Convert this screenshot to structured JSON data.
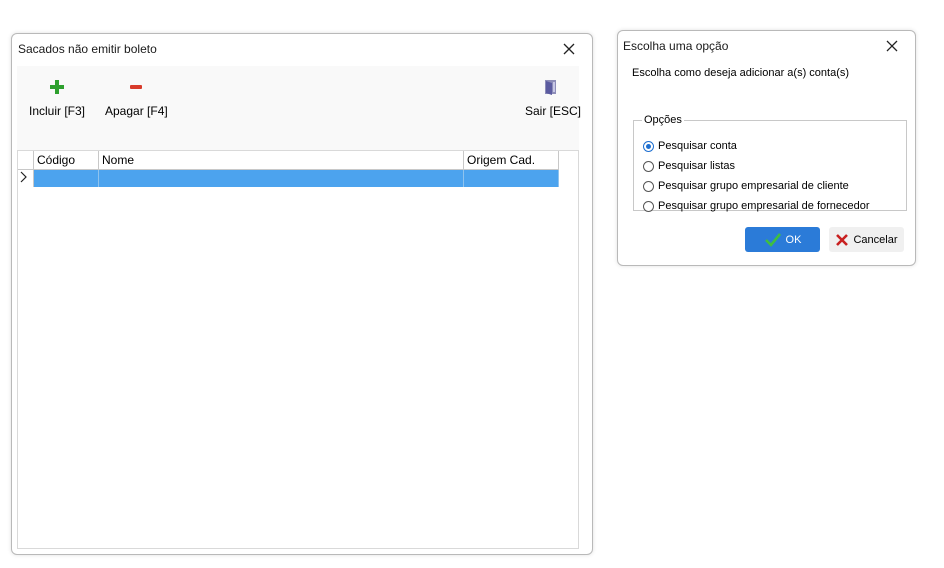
{
  "window1": {
    "title": "Sacados não emitir boleto",
    "toolbar": {
      "add_label": "Incluir [F3]",
      "delete_label": "Apagar [F4]",
      "exit_label": "Sair [ESC]"
    },
    "grid": {
      "columns": [
        "Código",
        "Nome",
        "Origem Cad."
      ],
      "rows": [
        [
          "",
          "",
          ""
        ]
      ]
    }
  },
  "window2": {
    "title": "Escolha uma opção",
    "prompt": "Escolha como deseja adicionar a(s) conta(s)",
    "group_label": "Opções",
    "options": [
      {
        "label": "Pesquisar conta",
        "selected": true
      },
      {
        "label": "Pesquisar listas",
        "selected": false
      },
      {
        "label": "Pesquisar grupo empresarial de cliente",
        "selected": false
      },
      {
        "label": "Pesquisar grupo empresarial de fornecedor",
        "selected": false
      }
    ],
    "ok_label": "OK",
    "cancel_label": "Cancelar"
  },
  "colors": {
    "selection": "#4ca3ee",
    "ok_button": "#2b7bd8",
    "add_icon": "#2ea02e",
    "delete_icon": "#d83b2b"
  },
  "icons": {
    "add": "plus-icon",
    "delete": "minus-icon",
    "exit": "exit-door-icon",
    "row_indicator": "chevron-right-icon",
    "ok": "check-icon",
    "cancel": "x-mark-icon",
    "close": "close-icon"
  }
}
